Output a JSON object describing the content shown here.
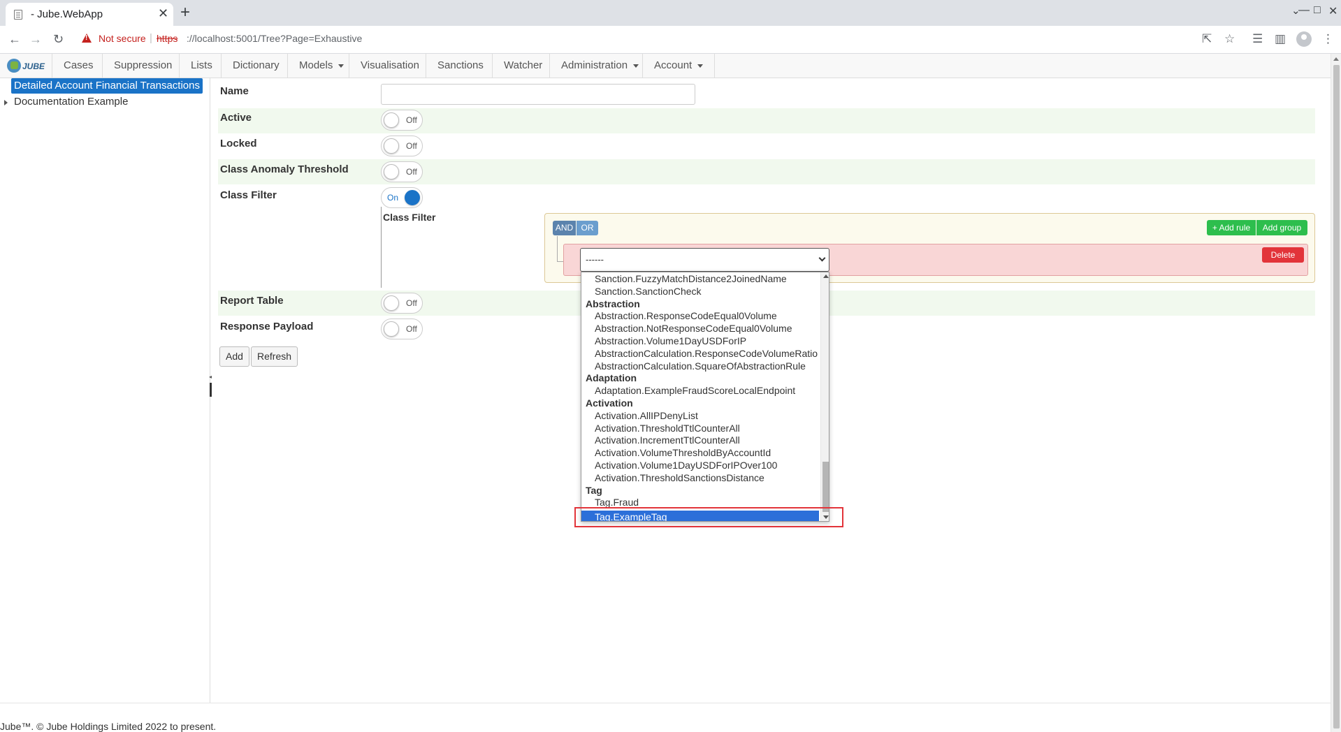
{
  "browser": {
    "tab_title": "- Jube.WebApp",
    "tab_close": "✕",
    "new_tab": "+",
    "security_label": "Not secure",
    "url_scheme": "https",
    "url_rest": "://localhost:5001/Tree?Page=Exhaustive",
    "separator": "|",
    "icons": [
      "back-icon",
      "forward-icon",
      "reload-icon",
      "share-icon",
      "star-icon",
      "reading-list-icon",
      "side-panel-icon",
      "profile-icon",
      "menu-icon"
    ]
  },
  "glyphs": {
    "back": "←",
    "forward": "→",
    "reload": "↻",
    "share": "⇱",
    "star": "☆",
    "reading_list": "☰",
    "side_panel": "▥",
    "menu": "⋮",
    "chevron": "⌄",
    "minimize": "—",
    "maximize": "□",
    "close": "✕"
  },
  "app": {
    "logo_text": "JUBE",
    "nav": [
      "Cases",
      "Suppression",
      "Lists",
      "Dictionary",
      "Models",
      "Visualisation",
      "Sanctions",
      "Watcher",
      "Administration",
      "Account"
    ]
  },
  "tree": {
    "root": "Detailed Account Financial Transactions",
    "child": "Documentation Example"
  },
  "form": {
    "name_label": "Name",
    "name_value": "",
    "active_label": "Active",
    "locked_label": "Locked",
    "class_anomaly_label": "Class Anomaly Threshold",
    "class_filter_label": "Class Filter",
    "class_filter_sublabel": "Class Filter",
    "report_table_label": "Report Table",
    "response_payload_label": "Response Payload",
    "toggle_off": "Off",
    "toggle_on": "On",
    "toggles": {
      "active": false,
      "locked": false,
      "class_anomaly": false,
      "class_filter": true,
      "report_table": false,
      "response_payload": false
    },
    "add_button": "Add",
    "refresh_button": "Refresh"
  },
  "query_builder": {
    "and_label": "AND",
    "or_label": "OR",
    "add_rule_label": "+ Add rule",
    "add_group_label": "Add group",
    "delete_label": "Delete",
    "selected_value": "------",
    "options": [
      {
        "label": "Sanction.FuzzyMatchDistance2JoinedName",
        "group": false
      },
      {
        "label": "Sanction.SanctionCheck",
        "group": false
      },
      {
        "label": "Abstraction",
        "group": true
      },
      {
        "label": "Abstraction.ResponseCodeEqual0Volume",
        "group": false
      },
      {
        "label": "Abstraction.NotResponseCodeEqual0Volume",
        "group": false
      },
      {
        "label": "Abstraction.Volume1DayUSDForIP",
        "group": false
      },
      {
        "label": "AbstractionCalculation.ResponseCodeVolumeRatio",
        "group": false
      },
      {
        "label": "AbstractionCalculation.SquareOfAbstractionRule",
        "group": false
      },
      {
        "label": "Adaptation",
        "group": true
      },
      {
        "label": "Adaptation.ExampleFraudScoreLocalEndpoint",
        "group": false
      },
      {
        "label": "Activation",
        "group": true
      },
      {
        "label": "Activation.AllIPDenyList",
        "group": false
      },
      {
        "label": "Activation.ThresholdTtlCounterAll",
        "group": false
      },
      {
        "label": "Activation.IncrementTtlCounterAll",
        "group": false
      },
      {
        "label": "Activation.VolumeThresholdByAccountId",
        "group": false
      },
      {
        "label": "Activation.Volume1DayUSDForIPOver100",
        "group": false
      },
      {
        "label": "Activation.ThresholdSanctionsDistance",
        "group": false
      },
      {
        "label": "Tag",
        "group": true
      },
      {
        "label": "Tag.Fraud",
        "group": false
      },
      {
        "label": "Tag.ExampleTag",
        "group": false,
        "selected": true
      }
    ]
  },
  "footer": "Jube™. © Jube Holdings Limited 2022 to present.",
  "colors": {
    "accent": "#1a73c7",
    "add_green": "#2dbe4d",
    "delete_red": "#e2343a",
    "highlight_red": "#e2343a",
    "row_tint": "#f1f9ee"
  }
}
